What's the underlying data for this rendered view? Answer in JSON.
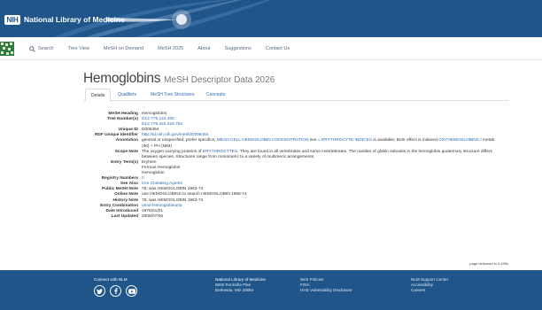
{
  "header": {
    "logo_text": "NIH",
    "org_name": "National Library of Medicine",
    "colors": {
      "banner": "#20558a",
      "link": "#2a6bb0"
    }
  },
  "nav": {
    "search_icon": "search-icon",
    "items": [
      {
        "label": "Search"
      },
      {
        "label": "Tree View"
      },
      {
        "label": "MeSH on Demand"
      },
      {
        "label": "MeSH 2025"
      },
      {
        "label": "About"
      },
      {
        "label": "Suggestions"
      },
      {
        "label": "Contact Us"
      }
    ]
  },
  "page": {
    "term": "Hemoglobins",
    "descriptor_type": "MeSH Descriptor Data 2026"
  },
  "tabs": [
    {
      "label": "Details",
      "active": true
    },
    {
      "label": "Qualifiers",
      "active": false
    },
    {
      "label": "MeSH Tree Structures",
      "active": false
    },
    {
      "label": "Concepts",
      "active": false
    }
  ],
  "details": {
    "mesh_heading": {
      "label": "MeSH Heading",
      "value": "Hemoglobins"
    },
    "tree_numbers": {
      "label": "Tree Number(s)",
      "values": [
        "D12.776.124.400",
        "D12.776.422.316.762"
      ]
    },
    "unique_id": {
      "label": "Unique ID",
      "value": "D006454"
    },
    "rdf_identifier": {
      "label": "RDF Unique Identifier",
      "value": "http://id.nlm.nih.gov/mesh/D006454"
    },
    "annotation": {
      "label": "Annotation",
      "p1": "general or unspecified; prefer specifics; ",
      "link1": "MEAN CELL HEMOGLOBIN CONCENTRATION",
      "p2": " see = ",
      "link2": "ERYTHROCYTE INDICES",
      "p3": " is available; Bohr effect is indexed ",
      "link3": "OXYHEMOGLOBINS",
      "p4": " / metab (IM) + PH (NIM)"
    },
    "scope_note": {
      "label": "Scope Note",
      "p1": "The oxygen-carrying proteins of ",
      "link1": "ERYTHROCYTES",
      "p2": ". They are found in all vertebrates and some invertebrates. The number of globin subunits in the hemoglobin quaternary structure differs between species. Structures range from monomeric to a variety of multimeric arrangements."
    },
    "entry_terms": {
      "label": "Entry Term(s)",
      "values": [
        "Eryhem",
        "Ferrous Hemoglobin",
        "Hemoglobin"
      ]
    },
    "registry_numbers": {
      "label": "Registry Numbers",
      "value": "0"
    },
    "see_also": {
      "label": "See Also",
      "value": "Iron Chelating Agents"
    },
    "public_mesh_note": {
      "label": "Public MeSH Note",
      "value": "75; was HEMOGLOBIN 1963-74"
    },
    "online_note": {
      "label": "Online Note",
      "value": "use HEMOGLOBINS to search HEMOGLOBIN 1966-74"
    },
    "history_note": {
      "label": "History Note",
      "value": "75; was HEMOGLOBIN 1963-74"
    },
    "entry_combination": {
      "label": "Entry Combination",
      "value": "urine:Hemoglobinuria"
    },
    "date_introduced": {
      "label": "Date Introduced",
      "value": "1975/01/01"
    },
    "last_updated": {
      "label": "Last Updated",
      "value": "2006/07/06"
    }
  },
  "status": {
    "page_delivered": "page delivered in 0.155s"
  },
  "footer": {
    "connect": {
      "heading": "Connect with NLM",
      "icons": [
        "twitter-icon",
        "facebook-icon",
        "youtube-icon"
      ]
    },
    "address": {
      "line1": "National Library of Medicine",
      "line2": "8600 Rockville Pike",
      "line3": "Bethesda, MD 20894"
    },
    "policies": {
      "line1": "Web Policies",
      "line2": "FOIA",
      "line3": "HHS Vulnerability Disclosure"
    },
    "support": {
      "line1": "NLM Support Center",
      "line2": "Accessibility",
      "line3": "Careers"
    }
  }
}
